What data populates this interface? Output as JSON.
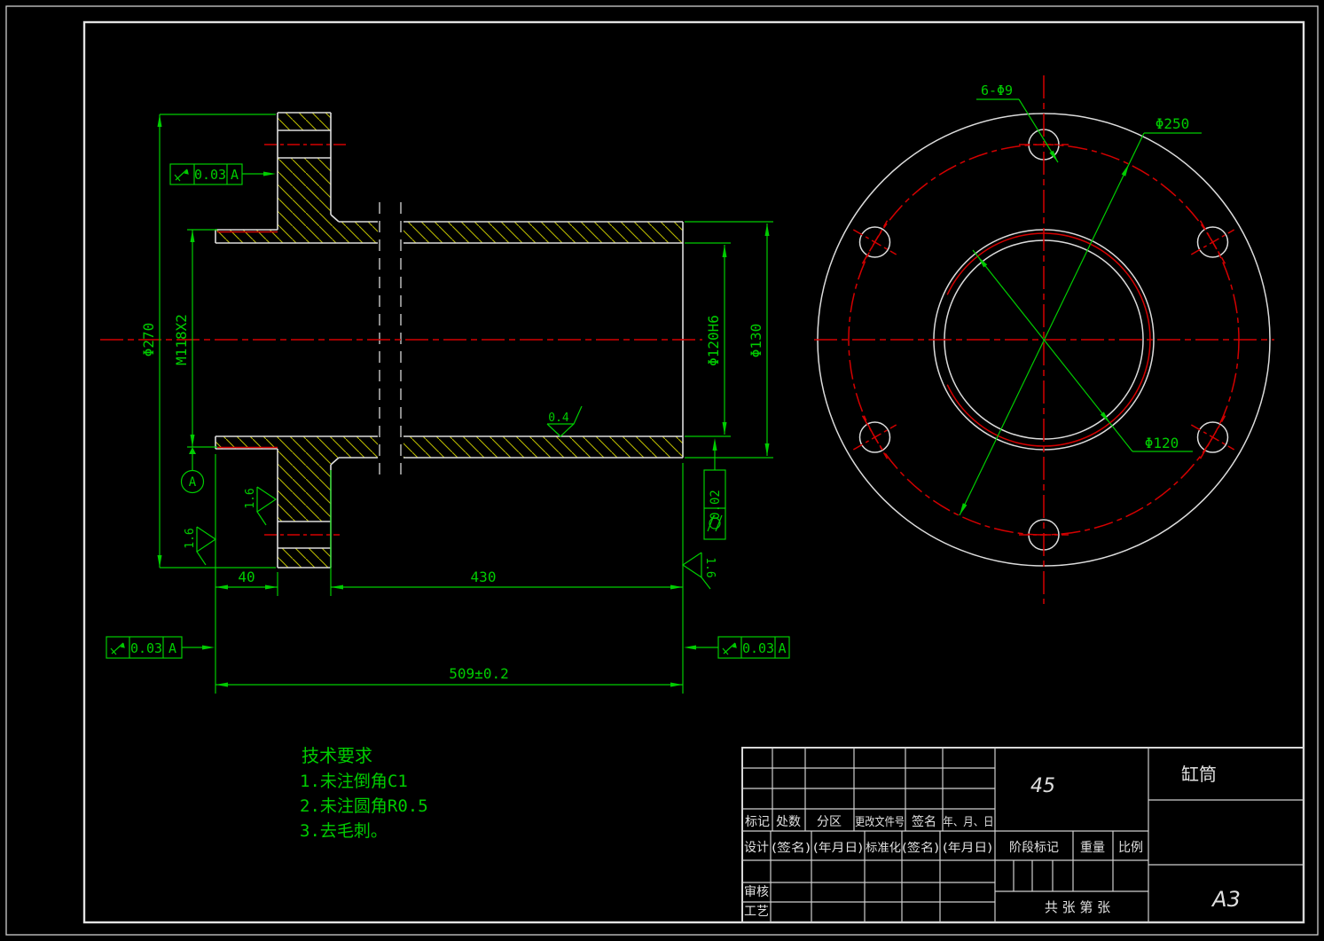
{
  "colors": {
    "green": "#00cc00",
    "red": "#d40000",
    "white": "#e0e0e0",
    "hatch_yellow": "#b9b900"
  },
  "section_view": {
    "dims": {
      "flange_od": "Φ270",
      "thread": "M118X2",
      "bore": "Φ120H6",
      "tube_od": "Φ130",
      "flange_offset": "40",
      "tube_length": "430",
      "total_length": "509±0.2"
    },
    "tolerances": {
      "runout_top_value": "0.03",
      "runout_top_datum": "A",
      "runout_bl_value": "0.03",
      "runout_bl_datum": "A",
      "runout_br_value": "0.03",
      "runout_br_datum": "A",
      "cylindricity_value": "0.02"
    },
    "surface_finish": {
      "bore": "0.4",
      "flange_face": "1.6",
      "left_end": "1.6",
      "right_end": "1.6"
    },
    "datum_label": "A"
  },
  "end_view": {
    "dims": {
      "bolt_holes": "6-Φ9",
      "bolt_circle": "Φ250",
      "bore": "Φ120"
    }
  },
  "technical_requirements": {
    "title": "技术要求",
    "item1": "1.未注倒角C1",
    "item2": "2.未注圆角R0.5",
    "item3": "3.去毛刺。"
  },
  "title_block": {
    "material": "45",
    "part_name": "缸筒",
    "sheet_size": "A3",
    "mark": "标记",
    "count": "处数",
    "zone": "分区",
    "change_file_no": "更改文件号",
    "signature": "签名",
    "date_ymd": "年、月、日",
    "design": "设计",
    "sign_paren": "(签名)",
    "date_paren": "(年月日)",
    "standardization": "标准化",
    "sign_paren2": "(签名)",
    "date_paren2": "(年月日)",
    "audit": "审核",
    "process": "工艺",
    "stage_mark": "阶段标记",
    "weight": "重量",
    "scale": "比例",
    "sheet_info": "共  张 第  张"
  }
}
